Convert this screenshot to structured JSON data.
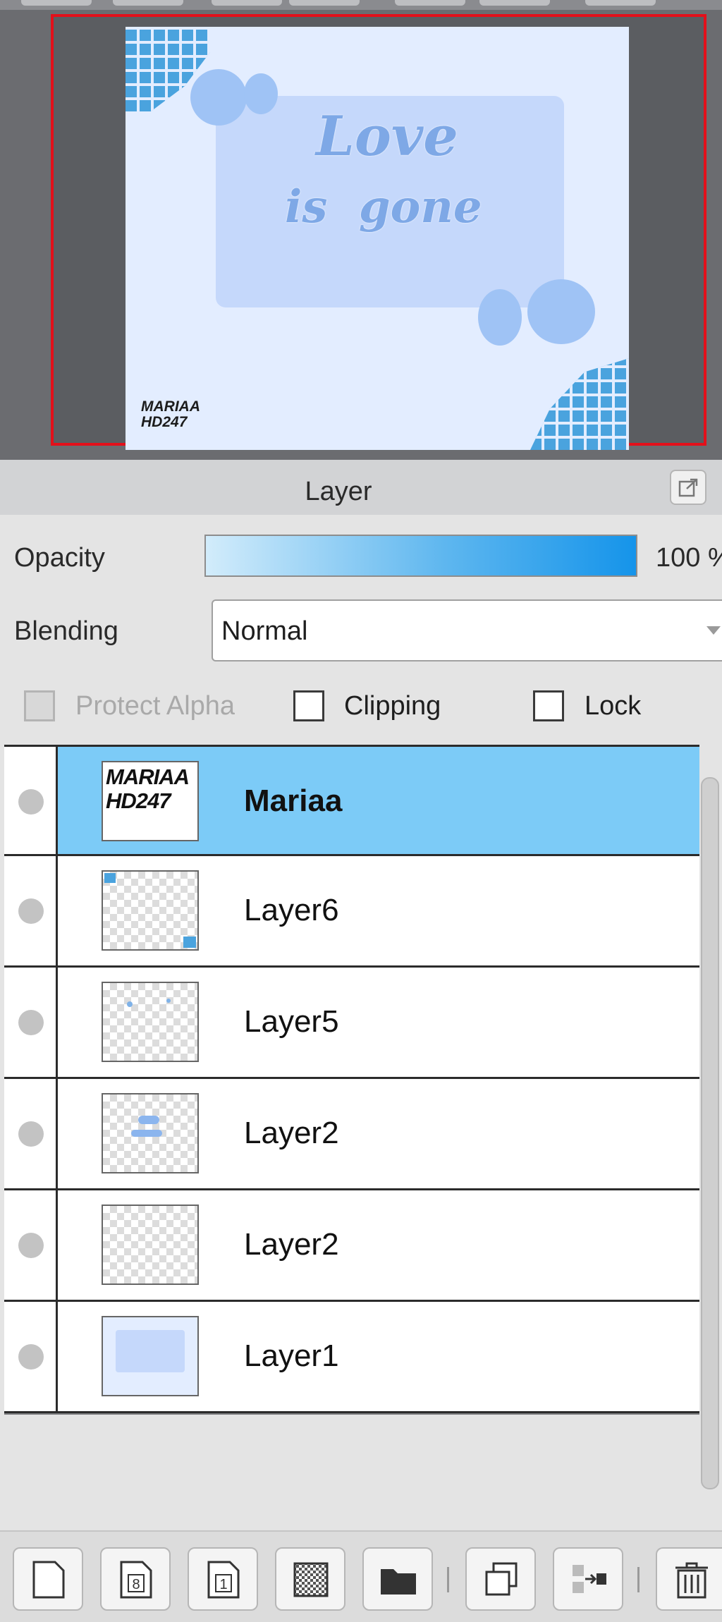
{
  "navigator": {
    "artwork_text": {
      "line1": "Love",
      "line2": "is  gone",
      "signature_line1": "MARIAA",
      "signature_line2": "HD247"
    }
  },
  "layer_panel": {
    "title": "Layer",
    "opacity_label": "Opacity",
    "opacity_value": "100 %",
    "opacity_fraction": 1.0,
    "blending_label": "Blending",
    "blending_value": "Normal",
    "checkboxes": {
      "protect_alpha": {
        "label": "Protect Alpha",
        "enabled": false,
        "checked": false
      },
      "clipping": {
        "label": "Clipping",
        "enabled": true,
        "checked": false
      },
      "lock": {
        "label": "Lock",
        "enabled": true,
        "checked": false
      }
    },
    "layers": [
      {
        "name": "Mariaa",
        "selected": true,
        "thumb_text_1": "MARIAA",
        "thumb_text_2": "HD247"
      },
      {
        "name": "Layer6",
        "selected": false
      },
      {
        "name": "Layer5",
        "selected": false
      },
      {
        "name": "Layer2",
        "selected": false
      },
      {
        "name": "Layer2",
        "selected": false
      },
      {
        "name": "Layer1",
        "selected": false
      }
    ]
  },
  "toolbar": {
    "buttons": [
      {
        "icon": "new-layer-icon"
      },
      {
        "icon": "new-8bit-layer-icon",
        "glyph": "8"
      },
      {
        "icon": "new-1bit-layer-icon",
        "glyph": "1"
      },
      {
        "icon": "new-halftone-layer-icon"
      },
      {
        "icon": "new-folder-icon"
      },
      {
        "icon": "duplicate-layer-icon"
      },
      {
        "icon": "merge-down-icon"
      },
      {
        "icon": "delete-layer-icon"
      }
    ]
  },
  "colors": {
    "selected_row": "#7ccbf7",
    "navigator_frame": "#e3101a",
    "opacity_bar_end": "#1594ea"
  }
}
